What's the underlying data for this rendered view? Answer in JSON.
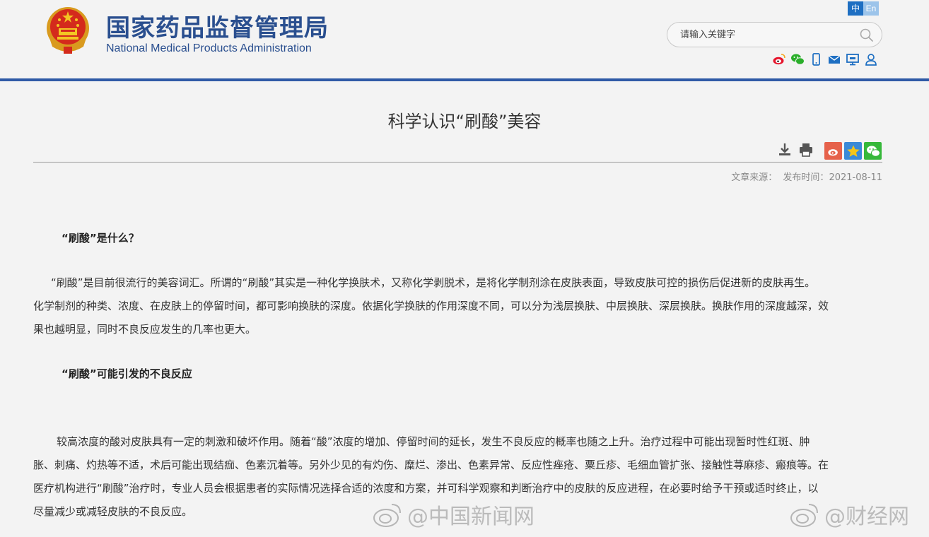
{
  "header": {
    "site_name_cn": "国家药品监督管理局",
    "site_name_en": "National Medical Products Administration",
    "lang": {
      "cn": "中",
      "en": "En"
    },
    "search": {
      "placeholder": "请输入关键字",
      "value": ""
    },
    "social_icons": [
      "weibo-icon",
      "wechat-icon",
      "mobile-icon",
      "mail-icon",
      "desktop-icon",
      "user-icon"
    ]
  },
  "article": {
    "title": "科学认识“刷酸”美容",
    "tools": [
      "download-icon",
      "print-icon"
    ],
    "share": [
      "weibo-share-icon",
      "favorite-star-icon",
      "wechat-share-icon"
    ],
    "meta": {
      "source_label": "文章来源：",
      "date_label": "发布时间：",
      "date": "2021-08-11"
    },
    "sections": [
      {
        "heading": "“刷酸”是什么？",
        "lines": [
          "“刷酸”是目前很流行的美容词汇。所谓的“刷酸”其实是一种化学换肤术，又称化学剥脱术，是将化学制剂涂在皮肤表面，导致皮肤可控的损伤后促进新的皮肤再生。",
          "化学制剂的种类、浓度、在皮肤上的停留时间，都可影响换肤的深度。依据化学换肤的作用深度不同，可以分为浅层换肤、中层换肤、深层换肤。换肤作用的深度越深，效",
          "果也越明显，同时不良反应发生的几率也更大。"
        ]
      },
      {
        "heading": "“刷酸”可能引发的不良反应",
        "lines": [
          "较高浓度的酸对皮肤具有一定的刺激和破坏作用。随着“酸”浓度的增加、停留时间的延长，发生不良反应的概率也随之上升。治疗过程中可能出现暂时性红斑、肿",
          "胀、刺痛、灼热等不适，术后可能出现结痂、色素沉着等。另外少见的有灼伤、糜烂、渗出、色素异常、反应性痤疮、粟丘疹、毛细血管扩张、接触性荨麻疹、瘢痕等。在",
          "医疗机构进行“刷酸”治疗时，专业人员会根据患者的实际情况选择合适的浓度和方案，并可科学观察和判断治疗中的皮肤的反应进程，在必要时给予干预或适时终止，以",
          "尽量减少或减轻皮肤的不良反应。"
        ]
      }
    ]
  },
  "watermarks": [
    "@中国新闻网",
    "@财经网"
  ],
  "colors": {
    "brand_blue": "#2a4f8f",
    "rule_blue": "#2f5aa6",
    "background": "#f3f3f3"
  }
}
